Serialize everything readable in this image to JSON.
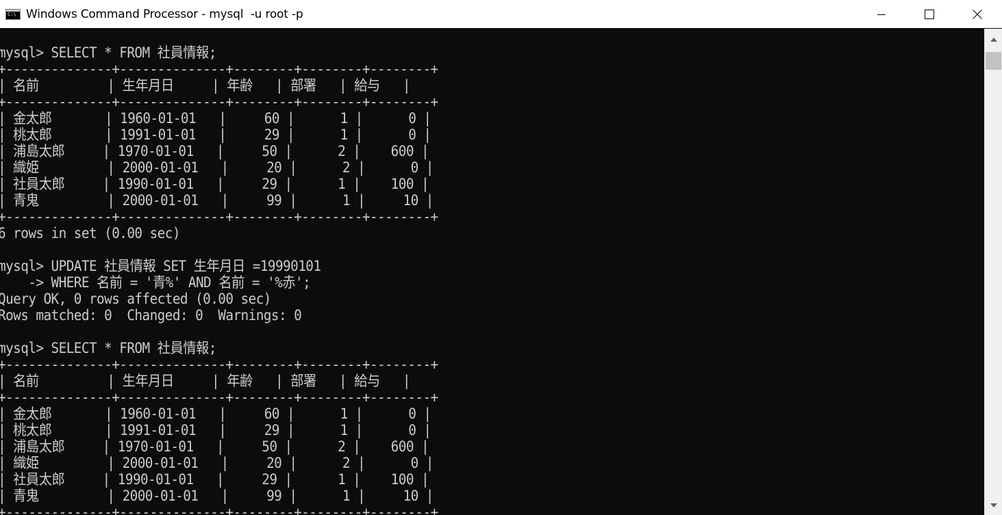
{
  "window": {
    "title": "Windows Command Processor - mysql  -u root -p",
    "icon": "cmd-icon",
    "controls": [
      "minimize-icon",
      "maximize-icon",
      "close-icon"
    ]
  },
  "console": {
    "lines": [
      "",
      "mysql> SELECT * FROM 社員情報;",
      "+--------------+--------------+--------+--------+--------+",
      "| 名前         | 生年月日     | 年齢   | 部署   | 給与   |",
      "+--------------+--------------+--------+--------+--------+",
      "| 金太郎       | 1960-01-01   |     60 |      1 |      0 |",
      "| 桃太郎       | 1991-01-01   |     29 |      1 |      0 |",
      "| 浦島太郎     | 1970-01-01   |     50 |      2 |    600 |",
      "| 織姫         | 2000-01-01   |     20 |      2 |      0 |",
      "| 社員太郎     | 1990-01-01   |     29 |      1 |    100 |",
      "| 青鬼         | 2000-01-01   |     99 |      1 |     10 |",
      "+--------------+--------------+--------+--------+--------+",
      "6 rows in set (0.00 sec)",
      "",
      "mysql> UPDATE 社員情報 SET 生年月日 =19990101",
      "    -> WHERE 名前 = '青%' AND 名前 = '%赤';",
      "Query OK, 0 rows affected (0.00 sec)",
      "Rows matched: 0  Changed: 0  Warnings: 0",
      "",
      "mysql> SELECT * FROM 社員情報;",
      "+--------------+--------------+--------+--------+--------+",
      "| 名前         | 生年月日     | 年齢   | 部署   | 給与   |",
      "+--------------+--------------+--------+--------+--------+",
      "| 金太郎       | 1960-01-01   |     60 |      1 |      0 |",
      "| 桃太郎       | 1991-01-01   |     29 |      1 |      0 |",
      "| 浦島太郎     | 1970-01-01   |     50 |      2 |    600 |",
      "| 織姫         | 2000-01-01   |     20 |      2 |      0 |",
      "| 社員太郎     | 1990-01-01   |     29 |      1 |    100 |",
      "| 青鬼         | 2000-01-01   |     99 |      1 |     10 |",
      "+--------------+--------------+--------+--------+--------+"
    ]
  },
  "scrollbar": {
    "up_icon": "scroll-up-arrow-icon",
    "down_icon": "scroll-down-arrow-icon",
    "position": 0.03
  },
  "colors": {
    "console_background": "#0c0c0c",
    "console_text": "#cccccc",
    "titlebar_background": "#ffffff"
  }
}
